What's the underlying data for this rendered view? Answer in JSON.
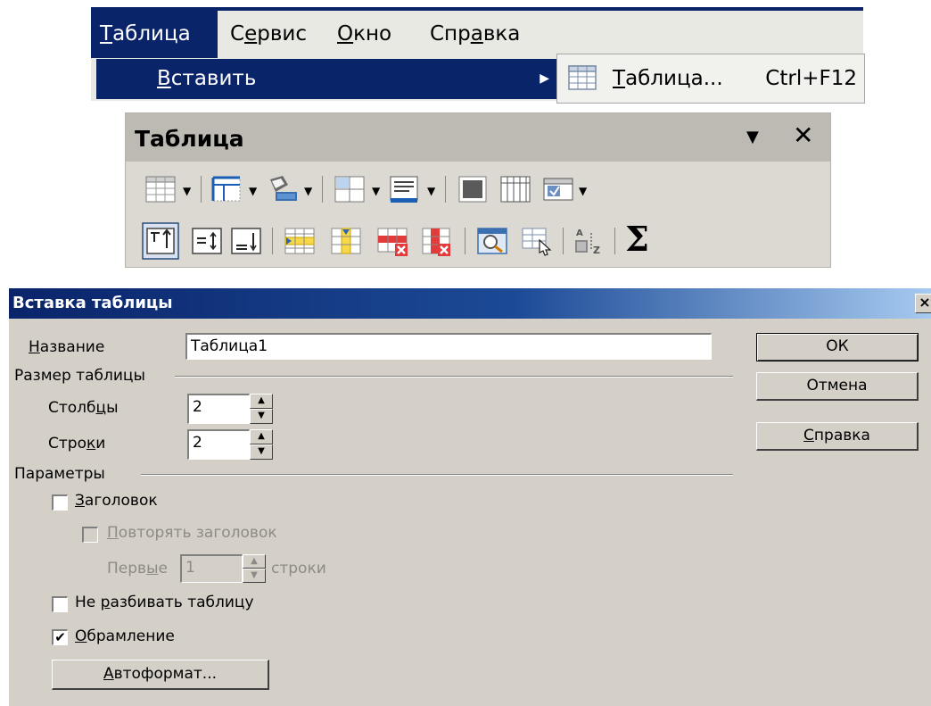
{
  "menubar": {
    "items": [
      {
        "pre": "",
        "key": "Т",
        "post": "аблица"
      },
      {
        "pre": "С",
        "key": "е",
        "post": "рвис"
      },
      {
        "pre": "",
        "key": "О",
        "post": "кно"
      },
      {
        "pre": "Спр",
        "key": "а",
        "post": "вка"
      }
    ]
  },
  "submenu": {
    "insert": {
      "pre": "",
      "key": "В",
      "post": "ставить"
    },
    "flyout": {
      "key": "Т",
      "post": "аблица...",
      "shortcut": "Ctrl+F12"
    }
  },
  "toolbar": {
    "title": "Таблица",
    "menu_arrow": "▼",
    "close": "✕",
    "row1_icons": [
      "insert-table-icon",
      "borders-icon",
      "border-style-icon",
      "cell-color-icon",
      "background-color-icon",
      "merge-cells-icon",
      "split-cells-icon",
      "optimize-icon"
    ],
    "row2_icons": [
      "align-top-icon",
      "center-vertically-icon",
      "align-bottom-icon",
      "insert-rows-icon",
      "insert-columns-icon",
      "delete-rows-icon",
      "delete-columns-icon",
      "table-properties-icon",
      "select-table-icon",
      "sort-icon",
      "sum-icon"
    ],
    "sum_symbol": "Σ"
  },
  "dialog": {
    "title": "Вставка таблицы",
    "close": "×",
    "name": {
      "label_key": "Н",
      "label_post": "азвание",
      "value": "Таблица1"
    },
    "size_group": "Размер таблицы",
    "columns": {
      "label_pre": "Столб",
      "label_key": "ц",
      "label_post": "ы",
      "value": "2"
    },
    "rows": {
      "label_pre": "Стро",
      "label_key": "к",
      "label_post": "и",
      "value": "2"
    },
    "params_group": "Параметры",
    "header": {
      "key": "З",
      "post": "аголовок",
      "checked": false
    },
    "repeat_header": {
      "key": "П",
      "post": "овторять заголовок",
      "checked": false
    },
    "first": {
      "pre": "Перв",
      "key": "ы",
      "post": "е",
      "value": "1",
      "suffix": "строки"
    },
    "no_split": {
      "pre": "Не ",
      "key": "р",
      "post": "азбивать таблицу",
      "checked": false
    },
    "border": {
      "key": "О",
      "post": "брамление",
      "checked": true,
      "mark": "✔"
    },
    "autoformat": {
      "key": "А",
      "post": "втоформат..."
    },
    "ok": "ОК",
    "cancel": "Отмена",
    "help": {
      "key": "С",
      "post": "правка"
    }
  },
  "colors": {
    "menu_highlight": "#0a246a",
    "dialog_face": "#d4d0c8",
    "toolbar_face": "#dbd9d2"
  }
}
